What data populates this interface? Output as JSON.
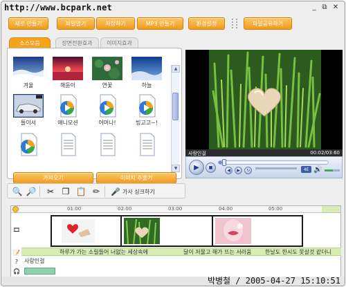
{
  "window": {
    "watermark": "http://www.bcpark.net",
    "controls": {
      "minimize": "_",
      "restore": "⧉",
      "close": "✕"
    }
  },
  "toolbar": {
    "buttons": [
      "새로 만들기",
      "파일열기",
      "저장하기",
      "MP3 만들기",
      "환경설정",
      "파일공유하기"
    ]
  },
  "library": {
    "tabs": [
      "소스모음",
      "장면전환효과",
      "이미지효과"
    ],
    "active_tab": "소스모음",
    "items": [
      {
        "label": "겨울",
        "icon": "winter-photo-thumbnail"
      },
      {
        "label": "해돋이",
        "icon": "sunrise-photo-thumbnail"
      },
      {
        "label": "연꽃",
        "icon": "lotus-photo-thumbnail"
      },
      {
        "label": "하늘",
        "icon": "sky-photo-thumbnail"
      },
      {
        "label": "들이서",
        "icon": "car-photo-thumbnail"
      },
      {
        "label": "애니모션",
        "icon": "media-file-icon"
      },
      {
        "label": "어머나!",
        "icon": "media-file-icon"
      },
      {
        "label": "빙고고~!",
        "icon": "media-file-icon"
      },
      {
        "label": "",
        "icon": "media-file-icon"
      },
      {
        "label": "",
        "icon": "text-file-icon"
      },
      {
        "label": "",
        "icon": "text-file-icon"
      },
      {
        "label": "",
        "icon": "text-file-icon"
      }
    ],
    "buttons": {
      "import": "가져오기",
      "extract": "이미지 추출기"
    }
  },
  "player": {
    "title": "사랑인걸",
    "time": "00:02/03:60",
    "progress": 0.03,
    "volume": 0.55,
    "mode_badge": "4E"
  },
  "edit_toolbar": {
    "icons": [
      "zoom-out-icon",
      "zoom-in-icon",
      "cut-icon",
      "copy-icon",
      "paste-icon",
      "erase-icon",
      "lyrics-sync-icon"
    ],
    "lyrics_sync": "가사 싱크하기"
  },
  "timeline": {
    "ruler_ticks": [
      "01:00",
      "02:00",
      "03:00",
      "04:00",
      "05:00"
    ],
    "clips": [
      "valentine-hands-clip",
      "heart-grass-clip",
      "kiss-lips-clip"
    ],
    "lyrics": [
      "하루가 가는 소릴들어 너없는 세상속에",
      "달이 저물고 해가 뜨는 서러움",
      "한날도 한시도 못살것 같더니"
    ],
    "audio_track": "사랑인걸"
  },
  "status": {
    "signature": "박병철 / 2005-04-27 15:10:51"
  },
  "colors": {
    "accent_orange": "#f6a31c",
    "lyric_green": "#d9ecb4",
    "clip_border": "#1a1a1a"
  }
}
